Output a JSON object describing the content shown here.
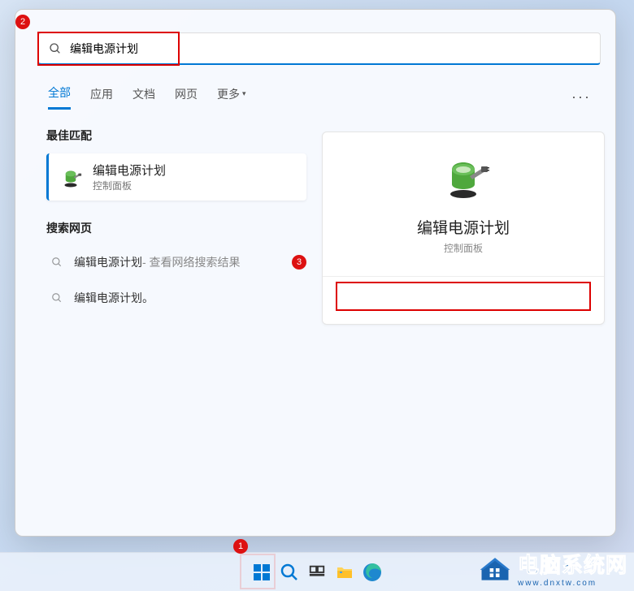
{
  "search": {
    "query": "编辑电源计划"
  },
  "tabs": {
    "all": "全部",
    "apps": "应用",
    "docs": "文档",
    "web": "网页",
    "more": "更多"
  },
  "sections": {
    "best_match": "最佳匹配",
    "search_web": "搜索网页"
  },
  "best": {
    "title": "编辑电源计划",
    "subtitle": "控制面板"
  },
  "webres": [
    {
      "prefix": "编辑电源计划",
      "suffix": " - 查看网络搜索结果",
      "has_chev": true
    },
    {
      "prefix": "编辑电源计划。",
      "suffix": "",
      "has_chev": false
    }
  ],
  "preview": {
    "title": "编辑电源计划",
    "subtitle": "控制面板"
  },
  "markers": {
    "m1": "1",
    "m2": "2",
    "m3": "3"
  },
  "watermark": {
    "title": "电脑系统网",
    "url": "www.dnxtw.com"
  }
}
